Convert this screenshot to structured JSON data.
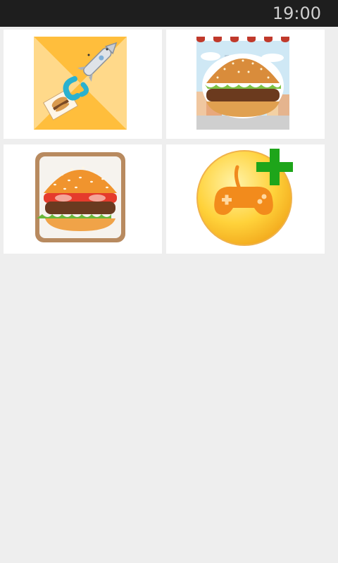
{
  "status_bar": {
    "time": "19:00"
  },
  "grid": {
    "tiles": [
      {
        "app": "rocket-burger-app",
        "icon": "rocket-burger-icon"
      },
      {
        "app": "burger-shop-app",
        "icon": "burger-city-icon"
      },
      {
        "app": "burger-maker-app",
        "icon": "burger-icon"
      },
      {
        "app": "more-games-app",
        "icon": "gamepad-plus-icon"
      }
    ]
  },
  "colors": {
    "status_bar": "#1e1e1e",
    "background": "#eeeeee",
    "tile": "#ffffff"
  }
}
